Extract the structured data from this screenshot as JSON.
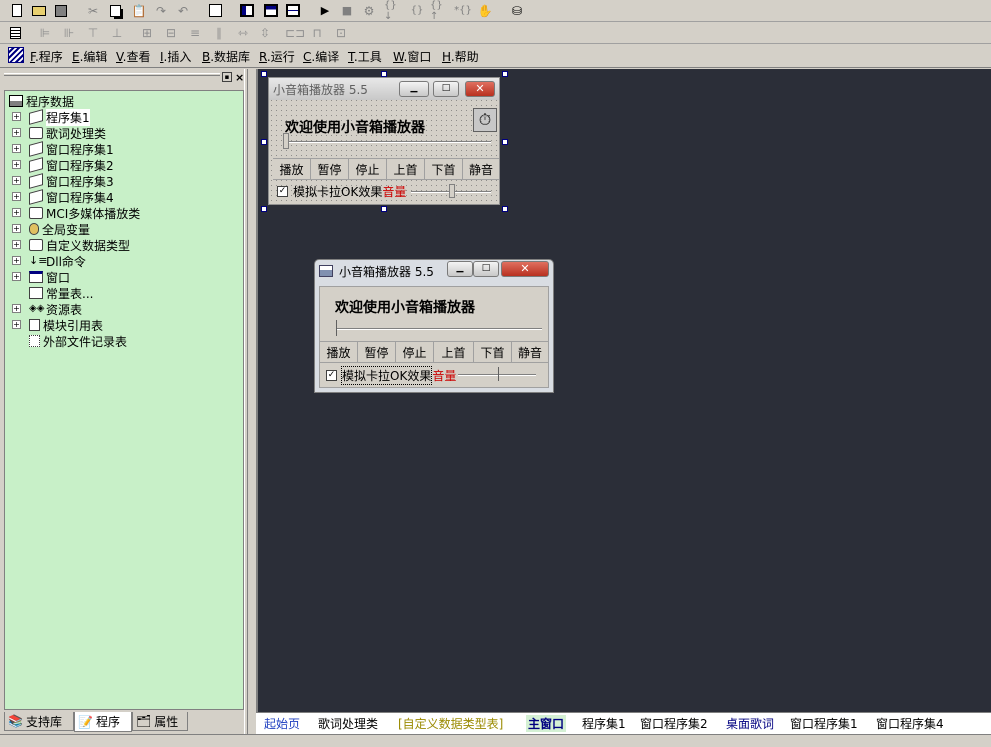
{
  "menu": [
    {
      "key": "F",
      "label": ".程序"
    },
    {
      "key": "E",
      "label": ".编辑"
    },
    {
      "key": "V",
      "label": ".查看"
    },
    {
      "key": "I",
      "label": ".插入"
    },
    {
      "key": "B",
      "label": ".数据库"
    },
    {
      "key": "R",
      "label": ".运行"
    },
    {
      "key": "C",
      "label": ".编译"
    },
    {
      "key": "T",
      "label": ".工具"
    },
    {
      "key": "W",
      "label": ".窗口"
    },
    {
      "key": "H",
      "label": ".帮助"
    }
  ],
  "tree": {
    "root": "程序数据",
    "items": [
      "程序集1",
      "歌词处理类",
      "窗口程序集1",
      "窗口程序集2",
      "窗口程序集3",
      "窗口程序集4",
      "MCI多媒体播放类",
      "全局变量",
      "自定义数据类型",
      "Dll命令",
      "窗口",
      "常量表...",
      "资源表",
      "模块引用表",
      "外部文件记录表"
    ]
  },
  "left_tabs": [
    "支持库",
    "程序",
    "属性"
  ],
  "doc_tabs": [
    "起始页",
    "歌词处理类",
    "[自定义数据类型表]",
    "主窗口",
    "程序集1",
    "窗口程序集2",
    "桌面歌词",
    "窗口程序集1",
    "窗口程序集4"
  ],
  "design_window": {
    "title": "小音箱播放器 5.5",
    "welcome": "欢迎使用小音箱播放器",
    "buttons": [
      "播放",
      "暂停",
      "停止",
      "上首",
      "下首",
      "静音"
    ],
    "karaoke": "模拟卡拉OK效果",
    "volume": "音量"
  },
  "preview_window": {
    "title": "小音箱播放器 5.5",
    "welcome": "欢迎使用小音箱播放器",
    "buttons": [
      "播放",
      "暂停",
      "停止",
      "上首",
      "下首",
      "静音"
    ],
    "karaoke": "模拟卡拉OK效果",
    "volume": "音量"
  },
  "colors": {
    "tree_bg": "#c8f0c8",
    "workspace": "#2b2e38",
    "volume_red": "#cc0000",
    "close_red": "#c8382a"
  }
}
